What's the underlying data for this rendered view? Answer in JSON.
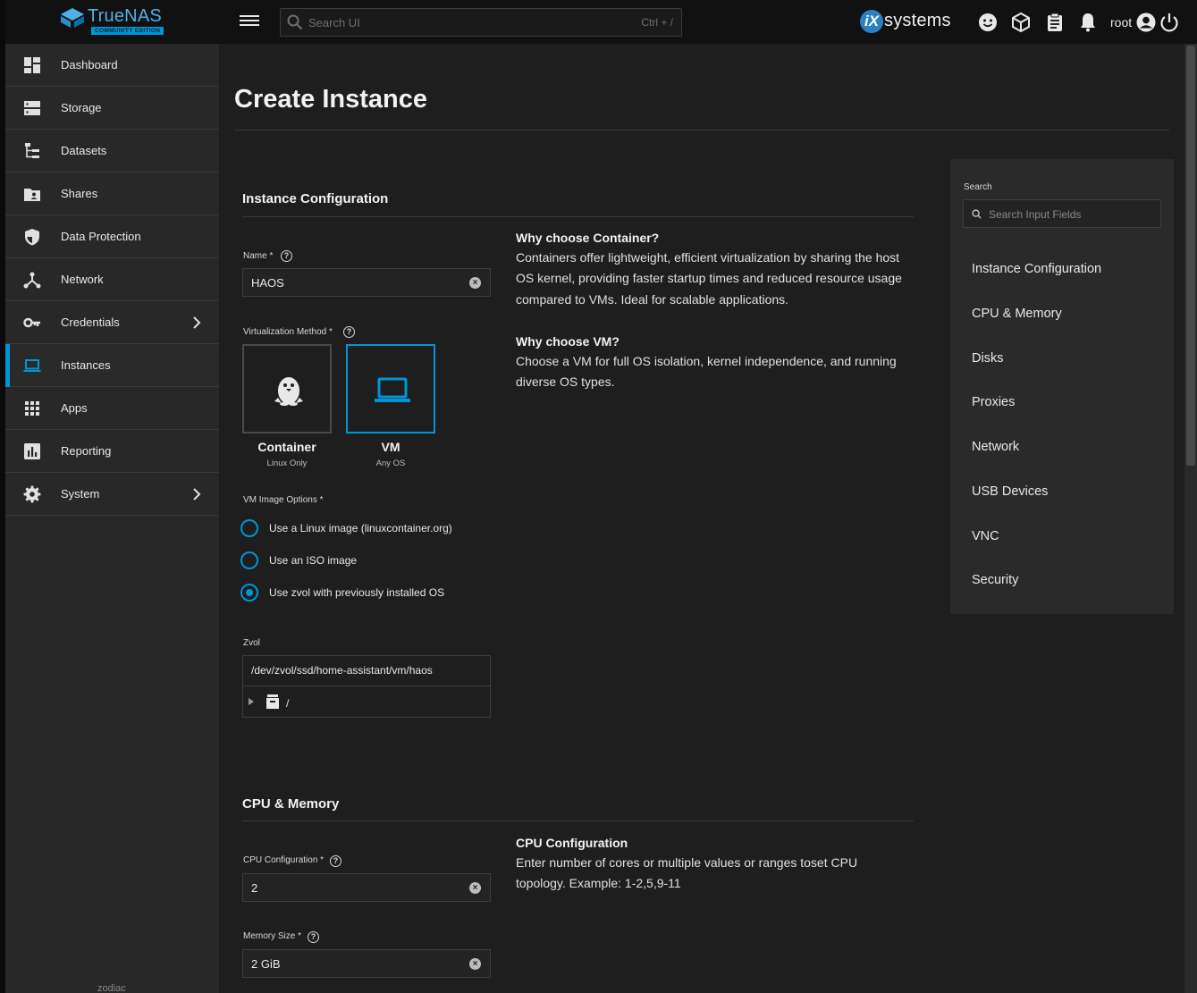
{
  "topbar": {
    "logo_text": "TrueNAS",
    "logo_badge": "COMMUNITY EDITION",
    "search_placeholder": "Search UI",
    "search_shortcut": "Ctrl + /",
    "vendor_logo_mark": "iX",
    "vendor_logo_text": "systems",
    "user": "root",
    "icons": [
      "feedback-icon",
      "truecommand-icon",
      "jobs-icon",
      "notifications-icon",
      "account-icon",
      "power-icon"
    ]
  },
  "sidebar": {
    "items": [
      {
        "label": "Dashboard",
        "icon": "dashboard-icon"
      },
      {
        "label": "Storage",
        "icon": "storage-icon"
      },
      {
        "label": "Datasets",
        "icon": "datasets-icon"
      },
      {
        "label": "Shares",
        "icon": "shares-icon"
      },
      {
        "label": "Data Protection",
        "icon": "shield-icon"
      },
      {
        "label": "Network",
        "icon": "network-icon"
      },
      {
        "label": "Credentials",
        "icon": "key-icon",
        "has_children": true
      },
      {
        "label": "Instances",
        "icon": "laptop-icon",
        "active": true
      },
      {
        "label": "Apps",
        "icon": "apps-grid-icon"
      },
      {
        "label": "Reporting",
        "icon": "chart-icon"
      },
      {
        "label": "System",
        "icon": "gear-icon",
        "has_children": true
      }
    ],
    "hostname": "zodiac"
  },
  "page": {
    "title": "Create Instance"
  },
  "instance_config": {
    "section_title": "Instance Configuration",
    "name_label": "Name *",
    "name_value": "HAOS",
    "virt_label": "Virtualization Method *",
    "container_title": "Container",
    "container_sub": "Linux Only",
    "vm_title": "VM",
    "vm_sub": "Any OS",
    "selected_method": "VM",
    "image_options_label": "VM Image Options *",
    "image_options": [
      {
        "label": "Use a Linux image (linuxcontainer.org)",
        "checked": false
      },
      {
        "label": "Use an ISO image",
        "checked": false
      },
      {
        "label": "Use zvol with previously installed OS",
        "checked": true
      }
    ],
    "zvol_label": "Zvol",
    "zvol_value": "/dev/zvol/ssd/home-assistant/vm/haos",
    "zvol_tree_root": "/",
    "help_container_title": "Why choose Container?",
    "help_container_text": "Containers offer lightweight, efficient virtualization by sharing the host OS kernel, providing faster startup times and reduced resource usage compared to VMs. Ideal for scalable applications.",
    "help_vm_title": "Why choose VM?",
    "help_vm_text": "Choose a VM for full OS isolation, kernel independence, and running diverse OS types."
  },
  "cpu_memory": {
    "section_title": "CPU & Memory",
    "cpu_label": "CPU Configuration *",
    "cpu_value": "2",
    "memory_label": "Memory Size *",
    "memory_value": "2 GiB",
    "help_cpu_title": "CPU Configuration",
    "help_cpu_text": "Enter number of cores or multiple values or ranges toset CPU topology. Example: 1-2,5,9-11"
  },
  "right_panel": {
    "search_label": "Search",
    "search_placeholder": "Search Input Fields",
    "links": [
      "Instance Configuration",
      "CPU & Memory",
      "Disks",
      "Proxies",
      "Network",
      "USB Devices",
      "VNC",
      "Security"
    ]
  },
  "colors": {
    "accent": "#0095d5",
    "topbar_bg": "#111111",
    "sidebar_bg": "#282828",
    "main_bg": "#1e1e1e",
    "panel_bg": "#2a2a2a"
  }
}
